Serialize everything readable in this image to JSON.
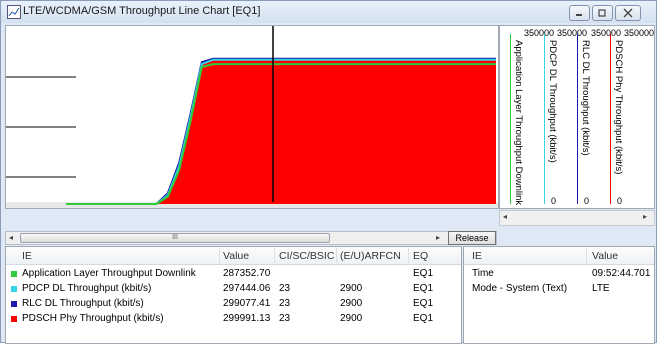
{
  "window": {
    "title": "LTE/WCDMA/GSM Throughput Line Chart [EQ1]",
    "app_icon": "chart-icon",
    "buttons": [
      "minimize-icon",
      "restore-icon",
      "close-icon"
    ]
  },
  "colors": {
    "app_layer": "#2ecc3a",
    "pdcp": "#33d6e6",
    "rlc": "#1a1aa8",
    "pdsch": "#ff0000"
  },
  "chart_data": {
    "type": "area",
    "series": [
      {
        "name": "PDSCH Phy Throughput (kbit/s)",
        "values": [
          0,
          0,
          0,
          0,
          0,
          0,
          0,
          0,
          0,
          20000,
          80000,
          180000,
          290000,
          300000,
          300000,
          300000,
          300000,
          300000,
          300000,
          300000,
          300000,
          300000,
          300000,
          300000,
          300000,
          300000,
          300000,
          300000,
          300000,
          300000,
          300000,
          300000,
          300000,
          300000,
          300000,
          300000,
          300000,
          300000,
          300000
        ]
      },
      {
        "name": "RLC DL Throughput (kbit/s)",
        "values": [
          0,
          0,
          0,
          0,
          0,
          0,
          0,
          0,
          0,
          22000,
          85000,
          185000,
          292000,
          299000,
          299000,
          299000,
          299000,
          299000,
          299000,
          299000,
          299000,
          299000,
          299000,
          299000,
          299000,
          299000,
          299000,
          299000,
          299000,
          299000,
          299000,
          299000,
          299000,
          299000,
          299000,
          299000,
          299000,
          299000,
          299000
        ]
      },
      {
        "name": "PDCP DL Throughput (kbit/s)",
        "values": [
          0,
          0,
          0,
          0,
          0,
          0,
          0,
          0,
          0,
          18000,
          78000,
          178000,
          288000,
          297000,
          297000,
          297000,
          297000,
          297000,
          297000,
          297000,
          297000,
          297000,
          297000,
          297000,
          297000,
          297000,
          297000,
          297000,
          297000,
          297000,
          297000,
          297000,
          297000,
          297000,
          297000,
          297000,
          297000,
          297000,
          297000
        ]
      },
      {
        "name": "Application Layer Throughput Downlink",
        "values": [
          0,
          0,
          0,
          0,
          0,
          0,
          0,
          0,
          0,
          15000,
          70000,
          170000,
          282000,
          288000,
          288000,
          288000,
          288000,
          288000,
          288000,
          288000,
          288000,
          288000,
          288000,
          288000,
          288000,
          288000,
          288000,
          288000,
          288000,
          288000,
          288000,
          288000,
          288000,
          288000,
          288000,
          288000,
          288000,
          288000,
          288000
        ]
      }
    ],
    "ylim": [
      0,
      350000
    ]
  },
  "axes_legend": {
    "scales": [
      "350000",
      "350000",
      "350000",
      "350000"
    ],
    "labels": [
      "Application Layer Throughput Downlink",
      "PDCP DL Throughput (kbit/s)",
      "RLC DL Throughput (kbit/s)",
      "PDSCH Phy Throughput (kbit/s)"
    ],
    "zeros": [
      "0",
      "0",
      "0"
    ]
  },
  "scrollbar": {
    "thumb_label": "III"
  },
  "release_label": "Release",
  "left_table": {
    "headers": [
      "IE",
      "Value",
      "CI/SC/BSIC",
      "(E/U)ARFCN",
      "EQ"
    ],
    "rows": [
      {
        "ie": "Application Layer Throughput Downlink",
        "value": "287352.70",
        "ci": "",
        "arfcn": "",
        "eq": "EQ1",
        "color": "#2ecc3a"
      },
      {
        "ie": "PDCP DL Throughput (kbit/s)",
        "value": "297444.06",
        "ci": "23",
        "arfcn": "2900",
        "eq": "EQ1",
        "color": "#33d6e6"
      },
      {
        "ie": "RLC DL Throughput (kbit/s)",
        "value": "299077.41",
        "ci": "23",
        "arfcn": "2900",
        "eq": "EQ1",
        "color": "#1a1aa8"
      },
      {
        "ie": "PDSCH Phy Throughput (kbit/s)",
        "value": "299991.13",
        "ci": "23",
        "arfcn": "2900",
        "eq": "EQ1",
        "color": "#ff0000"
      }
    ]
  },
  "right_table": {
    "headers": [
      "IE",
      "Value"
    ],
    "rows": [
      {
        "ie": "Time",
        "value": "09:52:44.701"
      },
      {
        "ie": "Mode - System (Text)",
        "value": "LTE"
      }
    ]
  }
}
